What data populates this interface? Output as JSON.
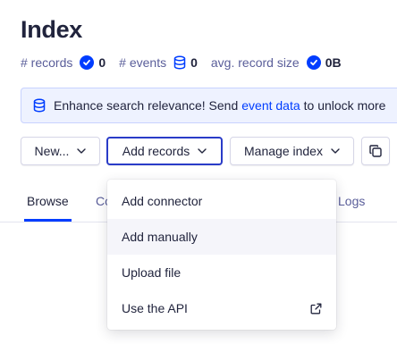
{
  "page": {
    "title": "Index"
  },
  "stats": {
    "records_label": "# records",
    "records_value": "0",
    "events_label": "# events",
    "events_value": "0",
    "size_label": "avg. record size",
    "size_value": "0B"
  },
  "banner": {
    "text_before": "Enhance search relevance! Send",
    "link": "event data",
    "text_after": "to unlock more"
  },
  "toolbar": {
    "new_label": "New...",
    "add_records_label": "Add records",
    "manage_index_label": "Manage index"
  },
  "tabs": {
    "browse": "Browse",
    "partial_left": "Co",
    "partial_right": "l Logs"
  },
  "menu": {
    "items": [
      {
        "label": "Add connector"
      },
      {
        "label": "Add manually"
      },
      {
        "label": "Upload file"
      },
      {
        "label": "Use the API",
        "icon": "external-link-icon"
      }
    ]
  },
  "colors": {
    "accent": "#003dff",
    "banner_bg": "#eef2ff",
    "text": "#21243d",
    "muted": "#5a5e9a"
  }
}
